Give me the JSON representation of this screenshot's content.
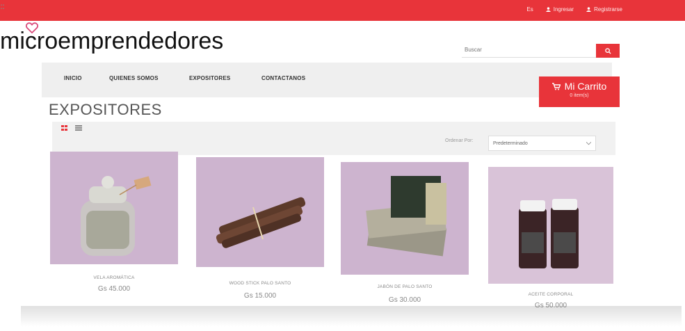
{
  "topbar": {
    "links": [
      {
        "label": "Es",
        "icon": ""
      },
      {
        "label": "Ingresar",
        "icon": "user-icon"
      },
      {
        "label": "Registrarse",
        "icon": "user-plus-icon"
      }
    ]
  },
  "brand": {
    "logo_text": "microemprendedores",
    "logo_dots": "::"
  },
  "search": {
    "placeholder": "Buscar",
    "icon": "search-icon"
  },
  "nav": {
    "items": [
      "INICIO",
      "QUIENES SOMOS",
      "EXPOSITORES",
      "CONTACTANOS"
    ]
  },
  "cart": {
    "label": "Mi Carrito",
    "count_text": "0 item(s)",
    "icon": "cart-icon"
  },
  "page": {
    "title": "EXPOSITORES"
  },
  "toolbar": {
    "sort_label": "Ordenar Por:",
    "sort_value": "Predeterminado"
  },
  "products": [
    {
      "name": "VELA AROMÁTICA",
      "price": "Gs 45.000"
    },
    {
      "name": "WOOD STICK PALO SANTO",
      "price": "Gs 15.000"
    },
    {
      "name": "JABÓN DE PALO SANTO",
      "price": "Gs 30.000"
    },
    {
      "name": "ACEITE CORPORAL",
      "price": "Gs 50.000"
    }
  ],
  "colors": {
    "accent": "#e8343a",
    "nav_bg": "#efefef",
    "product_bg": "#cdb4cf"
  }
}
